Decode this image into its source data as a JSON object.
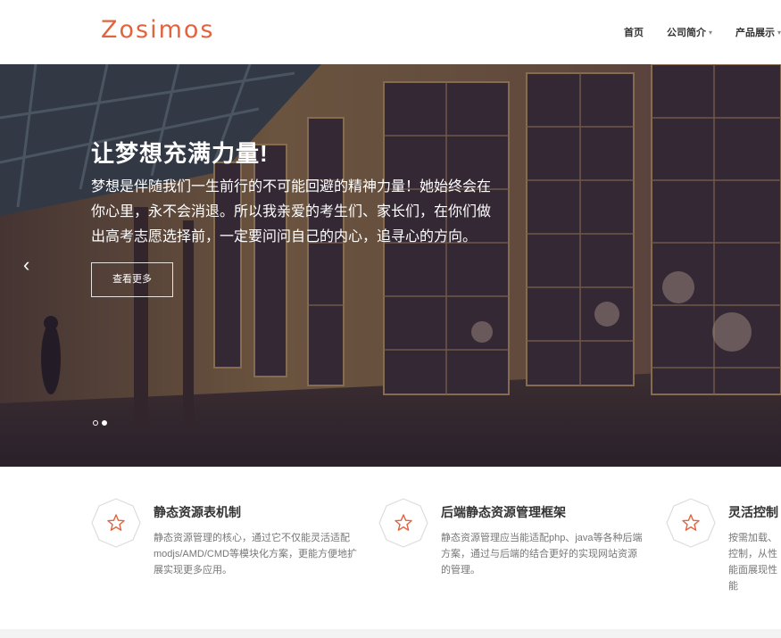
{
  "brand": {
    "logo_text": "Zosimos",
    "accent": "#e2643f"
  },
  "nav": {
    "items": [
      {
        "label": "首页",
        "has_dropdown": false
      },
      {
        "label": "公司简介",
        "has_dropdown": true
      },
      {
        "label": "产品展示",
        "has_dropdown": true
      }
    ],
    "caret": "▾"
  },
  "hero": {
    "title": "让梦想充满力量!",
    "description": "梦想是伴随我们一生前行的不可能回避的精神力量！她始终会在你心里，永不会消退。所以我亲爱的考生们、家长们，在你们做出高考志愿选择前，一定要问问自己的内心，追寻心的方向。",
    "button_label": "查看更多",
    "prev_arrow": "‹",
    "slides_count": 2,
    "active_slide": 2
  },
  "features": [
    {
      "icon": "star-icon",
      "title": "静态资源表机制",
      "text": "静态资源管理的核心，通过它不仅能灵活适配modjs/AMD/CMD等模块化方案，更能方便地扩展实现更多应用。"
    },
    {
      "icon": "star-icon",
      "title": "后端静态资源管理框架",
      "text": "静态资源管理应当能适配php、java等各种后端方案，通过与后端的结合更好的实现网站资源的管理。"
    },
    {
      "icon": "star-icon",
      "title": "灵活控制",
      "text": "按需加载、控制，从性能面展现性能"
    }
  ]
}
